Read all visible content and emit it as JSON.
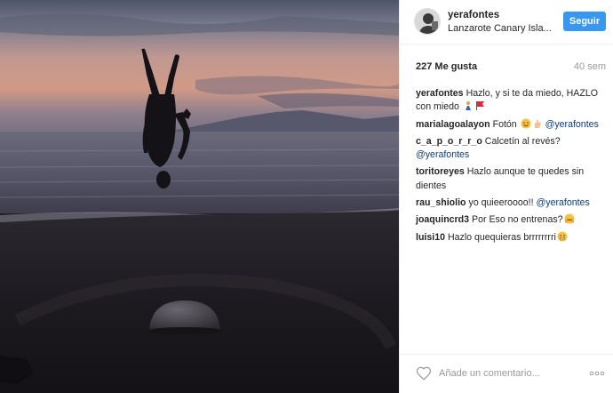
{
  "header": {
    "username": "yerafontes",
    "location": "Lanzarote Canary Isla...",
    "follow_label": "Seguir"
  },
  "stats": {
    "likes": "227 Me gusta",
    "time": "40 sem"
  },
  "comments": [
    {
      "user": "yerafontes",
      "text": "Hazlo, y si te da miedo, HAZLO con miedo",
      "emojis": [
        "person-icon",
        "flag-icon"
      ]
    },
    {
      "user": "marialagoalayon",
      "text": "Fotón",
      "emojis": [
        "smile-icon",
        "hand-icon"
      ],
      "mention": "@yerafontes"
    },
    {
      "user": "c_a_p_o_r_r_o",
      "text": "Calcetín al revés?",
      "mention": "@yerafontes"
    },
    {
      "user": "toritoreyes",
      "text": "Hazlo aunque te quedes sin dientes"
    },
    {
      "user": "rau_shiolio",
      "text": "yo quieeroooo!!",
      "mention": "@yerafontes"
    },
    {
      "user": "joaquincrd3",
      "text": "Por Eso no entrenas?",
      "emojis": [
        "hug-icon"
      ]
    },
    {
      "user": "luisi10",
      "text": "Hazlo quequieras brrrrrrrri",
      "emojis": [
        "cold-face-icon"
      ]
    }
  ],
  "footer": {
    "comment_placeholder": "Añade un comentario..."
  },
  "colors": {
    "follow": "#3897f0",
    "mention": "#0f3c7a",
    "muted": "#999999"
  }
}
